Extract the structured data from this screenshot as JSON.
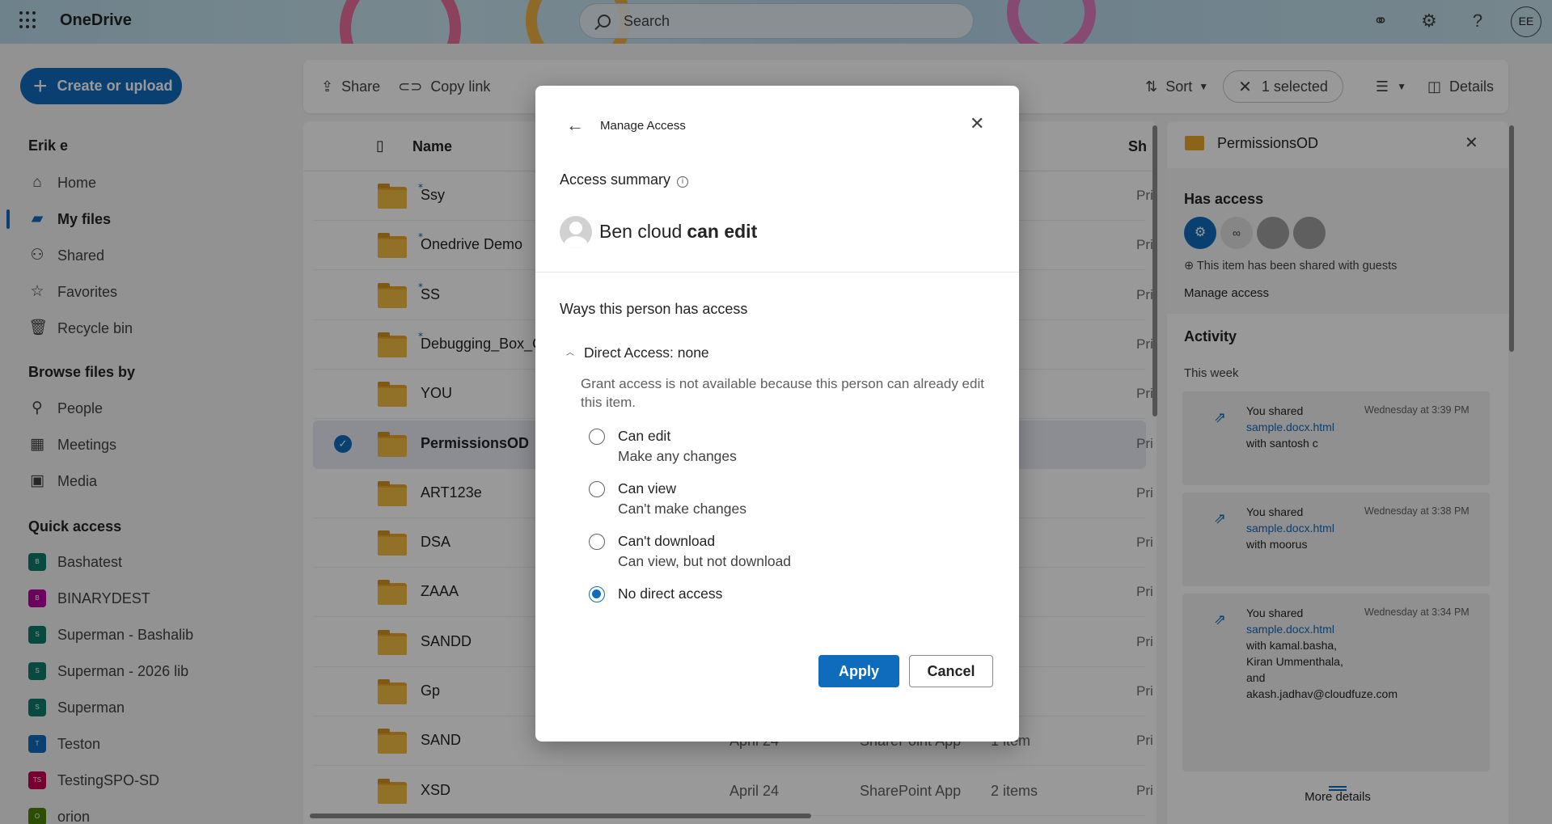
{
  "header": {
    "app_name": "OneDrive",
    "search_placeholder": "Search",
    "avatar_initials": "EE"
  },
  "nav": {
    "create_label": "Create or upload",
    "user_name": "Erik e",
    "items": [
      {
        "label": "Home",
        "icon": "home-icon"
      },
      {
        "label": "My files",
        "icon": "folder-icon"
      },
      {
        "label": "Shared",
        "icon": "people-icon"
      },
      {
        "label": "Favorites",
        "icon": "star-icon"
      },
      {
        "label": "Recycle bin",
        "icon": "trash-icon"
      }
    ],
    "browse_heading": "Browse files by",
    "browse": [
      {
        "label": "People",
        "icon": "person-icon"
      },
      {
        "label": "Meetings",
        "icon": "calendar-icon"
      },
      {
        "label": "Media",
        "icon": "image-icon"
      }
    ],
    "quick_heading": "Quick access",
    "quick": [
      {
        "label": "Bashatest",
        "badge": "B",
        "color": "#0e7a6b"
      },
      {
        "label": "BINARYDEST",
        "badge": "B",
        "color": "#b4009e"
      },
      {
        "label": "Superman - Bashalib",
        "badge": "S",
        "color": "#0e7a6b"
      },
      {
        "label": "Superman - 2026 lib",
        "badge": "S",
        "color": "#0e7a6b"
      },
      {
        "label": "Superman",
        "badge": "S",
        "color": "#0e7a6b"
      },
      {
        "label": "Teston",
        "badge": "T",
        "color": "#0f6cbd"
      },
      {
        "label": "TestingSPO-SD",
        "badge": "TS",
        "color": "#c30052"
      },
      {
        "label": "orion",
        "badge": "O",
        "color": "#498205"
      }
    ]
  },
  "toolbar": {
    "share": "Share",
    "copy_link": "Copy link",
    "more": "…",
    "sort": "Sort",
    "selected": "1 selected",
    "details": "Details"
  },
  "list": {
    "col_name": "Name",
    "col_shared": "Sh",
    "rows": [
      {
        "name": "Ssy",
        "new": true,
        "sharing": "Pri"
      },
      {
        "name": "Onedrive Demo",
        "new": true,
        "sharing": "Pri"
      },
      {
        "name": "SS",
        "new": true,
        "sharing": "Pri"
      },
      {
        "name": "Debugging_Box_C",
        "new": true,
        "sharing": "Pri"
      },
      {
        "name": "YOU",
        "new": false,
        "sharing": "Pri"
      },
      {
        "name": "PermissionsOD",
        "new": false,
        "sharing": "Pri",
        "selected": true
      },
      {
        "name": "ART123e",
        "new": false,
        "sharing": "Pri"
      },
      {
        "name": "DSA",
        "new": false,
        "sharing": "Pri"
      },
      {
        "name": "ZAAA",
        "new": false,
        "sharing": "Pri"
      },
      {
        "name": "SANDD",
        "new": false,
        "sharing": "Pri"
      },
      {
        "name": "Gp",
        "new": false,
        "sharing": "Pri"
      },
      {
        "name": "SAND",
        "new": false,
        "sharing": "Pri",
        "modified": "April 24",
        "by": "SharePoint App",
        "size": "1 item"
      },
      {
        "name": "XSD",
        "new": false,
        "sharing": "Pri",
        "modified": "April 24",
        "by": "SharePoint App",
        "size": "2 items"
      }
    ]
  },
  "details": {
    "title": "PermissionsOD",
    "has_access": "Has access",
    "guest_note": "This item has been shared with guests",
    "manage_access": "Manage access",
    "activity": "Activity",
    "this_week": "This week",
    "more_details": "More details",
    "activities": [
      {
        "who": "You shared",
        "file": "sample.docx.html",
        "with": "with santosh c",
        "when": "Wednesday at 3:39 PM"
      },
      {
        "who": "You shared",
        "file": "sample.docx.html",
        "with": "with moorus",
        "when": "Wednesday at 3:38 PM"
      },
      {
        "who": "You shared",
        "file": "sample.docx.html",
        "with": "with kamal.basha, Kiran Ummenthala, and akash.jadhav@cloudfuze.com",
        "when": "Wednesday at 3:34 PM"
      }
    ]
  },
  "dialog": {
    "title": "Manage Access",
    "access_summary": "Access summary",
    "person_name": "Ben cloud",
    "person_role": "can edit",
    "ways_heading": "Ways this person has access",
    "direct_access": "Direct Access: none",
    "grant_note": "Grant access is not available because this person can already edit this item.",
    "options": [
      {
        "label": "Can edit",
        "sub": "Make any changes",
        "selected": false
      },
      {
        "label": "Can view",
        "sub": "Can't make changes",
        "selected": false
      },
      {
        "label": "Can't download",
        "sub": "Can view, but not download",
        "selected": false
      },
      {
        "label": "No direct access",
        "sub": "",
        "selected": true
      }
    ],
    "apply": "Apply",
    "cancel": "Cancel"
  },
  "colors": {
    "accent": "#0f6cbd",
    "folder": "#f2bc43"
  }
}
